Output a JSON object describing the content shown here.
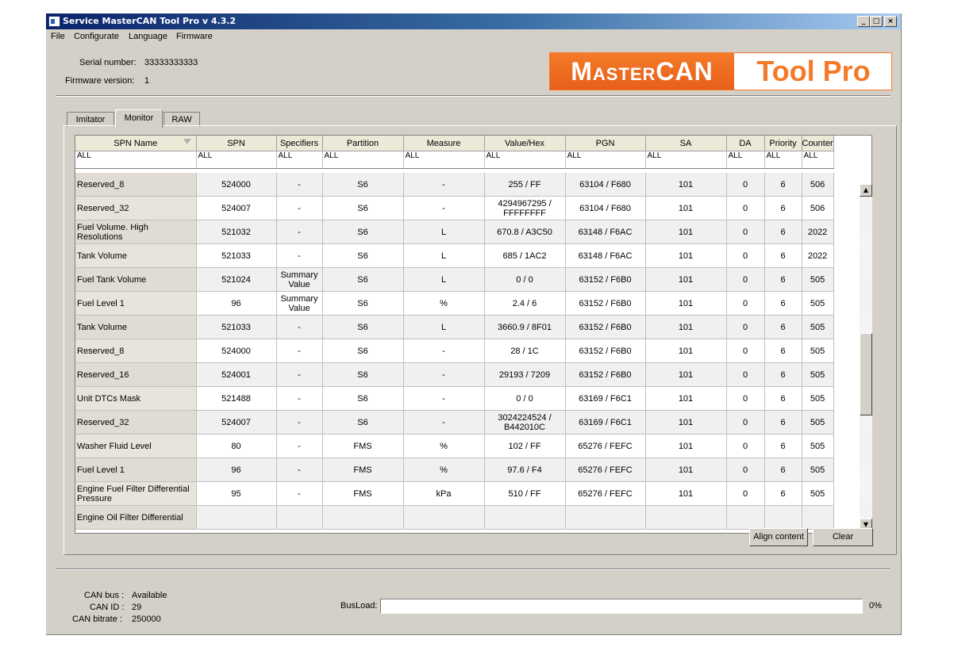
{
  "window": {
    "title": "Service MasterCAN Tool Pro v 4.3.2"
  },
  "menu": [
    "File",
    "Configurate",
    "Language",
    "Firmware"
  ],
  "device": {
    "serial_label": "Serial number:",
    "serial_value": "33333333333",
    "firmware_label": "Firmware version:",
    "firmware_value": "1"
  },
  "logo": {
    "left": "MasterCAN",
    "right": "Tool Pro",
    "brand_color": "#f47a28"
  },
  "tabs": [
    {
      "label": "Imitator",
      "active": false
    },
    {
      "label": "Monitor",
      "active": true
    },
    {
      "label": "RAW",
      "active": false
    }
  ],
  "table": {
    "columns": [
      "SPN Name",
      "SPN",
      "Specifiers",
      "Partition",
      "Measure",
      "Value/Hex",
      "PGN",
      "SA",
      "DA",
      "Priority",
      "Counter"
    ],
    "filters": [
      "ALL",
      "ALL",
      "ALL",
      "ALL",
      "ALL",
      "ALL",
      "ALL",
      "ALL",
      "ALL",
      "ALL",
      "ALL"
    ],
    "rows": [
      [
        "Reserved_8",
        "524000",
        "-",
        "S6",
        "-",
        "255 / FF",
        "63104  /  F680",
        "101",
        "0",
        "6",
        "506"
      ],
      [
        "Reserved_32",
        "524007",
        "-",
        "S6",
        "-",
        "4294967295 / FFFFFFFF",
        "63104  /  F680",
        "101",
        "0",
        "6",
        "506"
      ],
      [
        "Fuel Volume. High Resolutions",
        "521032",
        "-",
        "S6",
        "L",
        "670.8 / A3C50",
        "63148  /  F6AC",
        "101",
        "0",
        "6",
        "2022"
      ],
      [
        "Tank Volume",
        "521033",
        "-",
        "S6",
        "L",
        "685 / 1AC2",
        "63148  /  F6AC",
        "101",
        "0",
        "6",
        "2022"
      ],
      [
        "Fuel Tank Volume",
        "521024",
        "Summary Value",
        "S6",
        "L",
        "0 / 0",
        "63152  /  F6B0",
        "101",
        "0",
        "6",
        "505"
      ],
      [
        "Fuel Level 1",
        "96",
        "Summary Value",
        "S6",
        "%",
        "2.4 / 6",
        "63152  /  F6B0",
        "101",
        "0",
        "6",
        "505"
      ],
      [
        "Tank Volume",
        "521033",
        "-",
        "S6",
        "L",
        "3660.9 / 8F01",
        "63152  /  F6B0",
        "101",
        "0",
        "6",
        "505"
      ],
      [
        "Reserved_8",
        "524000",
        "-",
        "S6",
        "-",
        "28 / 1C",
        "63152  /  F6B0",
        "101",
        "0",
        "6",
        "505"
      ],
      [
        "Reserved_16",
        "524001",
        "-",
        "S6",
        "-",
        "29193 / 7209",
        "63152  /  F6B0",
        "101",
        "0",
        "6",
        "505"
      ],
      [
        "Unit DTCs Mask",
        "521488",
        "-",
        "S6",
        "-",
        "0 / 0",
        "63169  /  F6C1",
        "101",
        "0",
        "6",
        "505"
      ],
      [
        "Reserved_32",
        "524007",
        "-",
        "S6",
        "-",
        "3024224524 / B442010C",
        "63169  /  F6C1",
        "101",
        "0",
        "6",
        "505"
      ],
      [
        "Washer Fluid Level",
        "80",
        "-",
        "FMS",
        "%",
        "102 / FF",
        "65276  /  FEFC",
        "101",
        "0",
        "6",
        "505"
      ],
      [
        "Fuel Level 1",
        "96",
        "-",
        "FMS",
        "%",
        "97.6 / F4",
        "65276  /  FEFC",
        "101",
        "0",
        "6",
        "505"
      ],
      [
        "Engine Fuel Filter Differential Pressure",
        "95",
        "-",
        "FMS",
        "kPa",
        "510 / FF",
        "65276  /  FEFC",
        "101",
        "0",
        "6",
        "505"
      ],
      [
        "Engine Oil Filter Differential",
        "",
        "",
        "",
        "",
        "",
        "",
        "",
        "",
        "",
        ""
      ]
    ]
  },
  "buttons": {
    "align": "Align content",
    "clear": "Clear"
  },
  "status": {
    "can_bus_label": "CAN bus :",
    "can_bus_value": "Available",
    "can_id_label": "CAN ID :",
    "can_id_value": "29",
    "bitrate_label": "CAN bitrate :",
    "bitrate_value": "250000",
    "busload_label": "BusLoad:",
    "busload_value": "0%",
    "busload_fraction": 0
  }
}
